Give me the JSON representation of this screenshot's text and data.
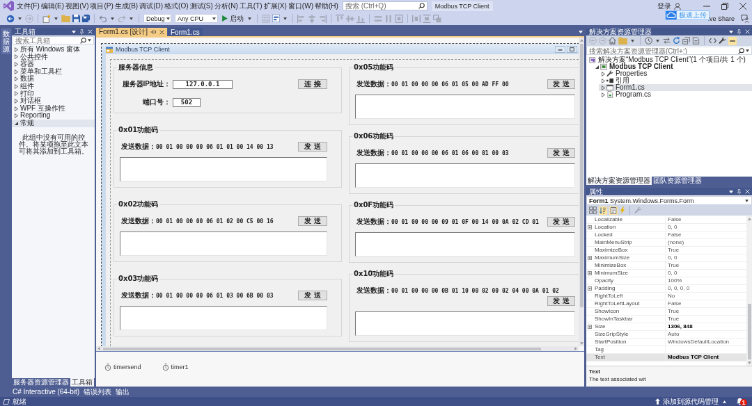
{
  "window": {
    "title": "Modbus TCP Client",
    "search": {
      "placeholder": "搜索 (Ctrl+Q)"
    },
    "sign_in": "登录"
  },
  "menu": [
    "文件(F)",
    "编辑(E)",
    "视图(V)",
    "项目(P)",
    "生成(B)",
    "调试(D)",
    "格式(O)",
    "测试(S)",
    "分析(N)",
    "工具(T)",
    "扩展(X)",
    "窗口(W)",
    "帮助(H)"
  ],
  "toolbar": {
    "configuration": "Debug",
    "platform": "Any CPU",
    "start": "启动",
    "live_share": "ive Share"
  },
  "upload_popup": {
    "label": "极速上传"
  },
  "side_strip": {
    "tab": "数据源"
  },
  "toolbox": {
    "title": "工具箱",
    "search": {
      "placeholder": "搜索工具箱"
    },
    "categories": [
      {
        "label": "所有 Windows 窗体",
        "expanded": false
      },
      {
        "label": "公共控件",
        "expanded": false
      },
      {
        "label": "容器",
        "expanded": false
      },
      {
        "label": "菜单和工具栏",
        "expanded": false
      },
      {
        "label": "数据",
        "expanded": false
      },
      {
        "label": "组件",
        "expanded": false
      },
      {
        "label": "打印",
        "expanded": false
      },
      {
        "label": "对话框",
        "expanded": false
      },
      {
        "label": "WPF 互操作性",
        "expanded": false
      },
      {
        "label": "Reporting",
        "expanded": false
      },
      {
        "label": "常规",
        "expanded": true,
        "empty_message": "此组中没有可用的控件。将某项拖至此文本可将其添加到工具箱。"
      }
    ],
    "tabs": [
      {
        "label": "服务器资源管理器",
        "selected": false
      },
      {
        "label": "工具箱",
        "selected": true
      }
    ]
  },
  "document_tabs": [
    {
      "label": "Form1.cs [设计]",
      "selected": true
    },
    {
      "label": "Form1.cs",
      "selected": false
    }
  ],
  "designer": {
    "form": {
      "title": "Modbus TCP Client",
      "columns": [
        {
          "groups": [
            {
              "kind": "server",
              "title": "服务器信息",
              "ip_label": "服务器IP地址：",
              "ip_value": "127.0.0.1",
              "connect_button": "连 接",
              "port_label": "端口号：",
              "port_value": "502"
            },
            {
              "kind": "function",
              "title": "0x01功能码",
              "send_label": "发送数据：",
              "send_data": "00 01 00 00 00 06 01 01 00 14 00 13",
              "send_button": "发 送"
            },
            {
              "kind": "function",
              "title": "0x02功能码",
              "send_label": "发送数据：",
              "send_data": "00 01 00 00 00 06 01 02 00 C5 00 16",
              "send_button": "发 送"
            },
            {
              "kind": "function",
              "title": "0x03功能码",
              "send_label": "发送数据：",
              "send_data": "00 01 00 00 00 06 01 03 00 6B 00 03",
              "send_button": "发 送"
            }
          ]
        },
        {
          "groups": [
            {
              "kind": "function",
              "title": "0x05功能码",
              "send_label": "发送数据：",
              "send_data": "00 01 00 00 00 06 01 05 00 AD FF 00",
              "send_button": "发 送"
            },
            {
              "kind": "function",
              "title": "0x06功能码",
              "send_label": "发送数据：",
              "send_data": "00 01 00 00 00 06 01 06 00 01 00 03",
              "send_button": "发 送"
            },
            {
              "kind": "function",
              "title": "0x0F功能码",
              "send_label": "发送数据：",
              "send_data": "00 01 00 00 00 09 01 0F 00 14 00 0A 02 CD 01",
              "send_button": "发 送"
            },
            {
              "kind": "function",
              "title": "0x10功能码",
              "send_label": "发送数据：",
              "send_data": "00 01 00 00 00 0B 01 10 00 02 00 02 04 00 0A 01 02",
              "send_button": "发 送"
            }
          ]
        }
      ]
    },
    "components": [
      "timersend",
      "timer1"
    ]
  },
  "solution_explorer": {
    "title": "解决方案资源管理器",
    "search": {
      "placeholder": "搜索解决方案资源管理器(Ctrl+;)"
    },
    "tree": [
      {
        "label": "解决方案“Modbus TCP Client”(1 个项目/共 1 个)",
        "kind": "solution",
        "selected": false,
        "children": [
          {
            "label": "Modbus TCP Client",
            "kind": "project",
            "expanded": true,
            "selected": false,
            "children": [
              {
                "label": "Properties",
                "kind": "properties",
                "expanded": false,
                "selected": false
              },
              {
                "label": "引用",
                "kind": "references",
                "expanded": false,
                "selected": false
              },
              {
                "label": "Form1.cs",
                "kind": "form",
                "expanded": false,
                "selected": true
              },
              {
                "label": "Program.cs",
                "kind": "code",
                "expanded": false,
                "selected": false
              }
            ]
          }
        ]
      }
    ],
    "tabs": [
      {
        "label": "解决方案资源管理器",
        "selected": true
      },
      {
        "label": "团队资源管理器",
        "selected": false
      }
    ]
  },
  "properties": {
    "title": "属性",
    "object": "**Form1** System.Windows.Forms.Form",
    "rows": [
      {
        "name": "Localizable",
        "value": "False",
        "expandable": false,
        "modified": false,
        "selected": false
      },
      {
        "name": "Location",
        "value": "0, 0",
        "expandable": true,
        "modified": false,
        "selected": false
      },
      {
        "name": "Locked",
        "value": "False",
        "expandable": false,
        "modified": false,
        "selected": false
      },
      {
        "name": "MainMenuStrip",
        "value": "(none)",
        "expandable": false,
        "modified": false,
        "selected": false
      },
      {
        "name": "MaximizeBox",
        "value": "True",
        "expandable": false,
        "modified": false,
        "selected": false
      },
      {
        "name": "MaximumSize",
        "value": "0, 0",
        "expandable": true,
        "modified": false,
        "selected": false
      },
      {
        "name": "MinimizeBox",
        "value": "True",
        "expandable": false,
        "modified": false,
        "selected": false
      },
      {
        "name": "MinimumSize",
        "value": "0, 0",
        "expandable": true,
        "modified": false,
        "selected": false
      },
      {
        "name": "Opacity",
        "value": "100%",
        "expandable": false,
        "modified": false,
        "selected": false
      },
      {
        "name": "Padding",
        "value": "0, 0, 0, 0",
        "expandable": true,
        "modified": false,
        "selected": false
      },
      {
        "name": "RightToLeft",
        "value": "No",
        "expandable": false,
        "modified": false,
        "selected": false
      },
      {
        "name": "RightToLeftLayout",
        "value": "False",
        "expandable": false,
        "modified": false,
        "selected": false
      },
      {
        "name": "ShowIcon",
        "value": "True",
        "expandable": false,
        "modified": false,
        "selected": false
      },
      {
        "name": "ShowInTaskbar",
        "value": "True",
        "expandable": false,
        "modified": false,
        "selected": false
      },
      {
        "name": "Size",
        "value": "1306, 848",
        "expandable": true,
        "modified": true,
        "selected": false
      },
      {
        "name": "SizeGripStyle",
        "value": "Auto",
        "expandable": false,
        "modified": false,
        "selected": false
      },
      {
        "name": "StartPosition",
        "value": "WindowsDefaultLocation",
        "expandable": false,
        "modified": false,
        "selected": false
      },
      {
        "name": "Tag",
        "expandable": false,
        "selected": false
      },
      {
        "name": "Text",
        "value": "Modbus TCP Client",
        "expandable": false,
        "modified": true,
        "selected": true
      }
    ],
    "description": {
      "title": "Text",
      "text": "The text associated wit"
    }
  },
  "bottom_tabs": [
    "C# Interactive (64-bit)",
    "错误列表",
    "输出"
  ],
  "status_bar": {
    "text": "就绪",
    "source_control": "添加到源代码管理",
    "notifications": "1"
  }
}
